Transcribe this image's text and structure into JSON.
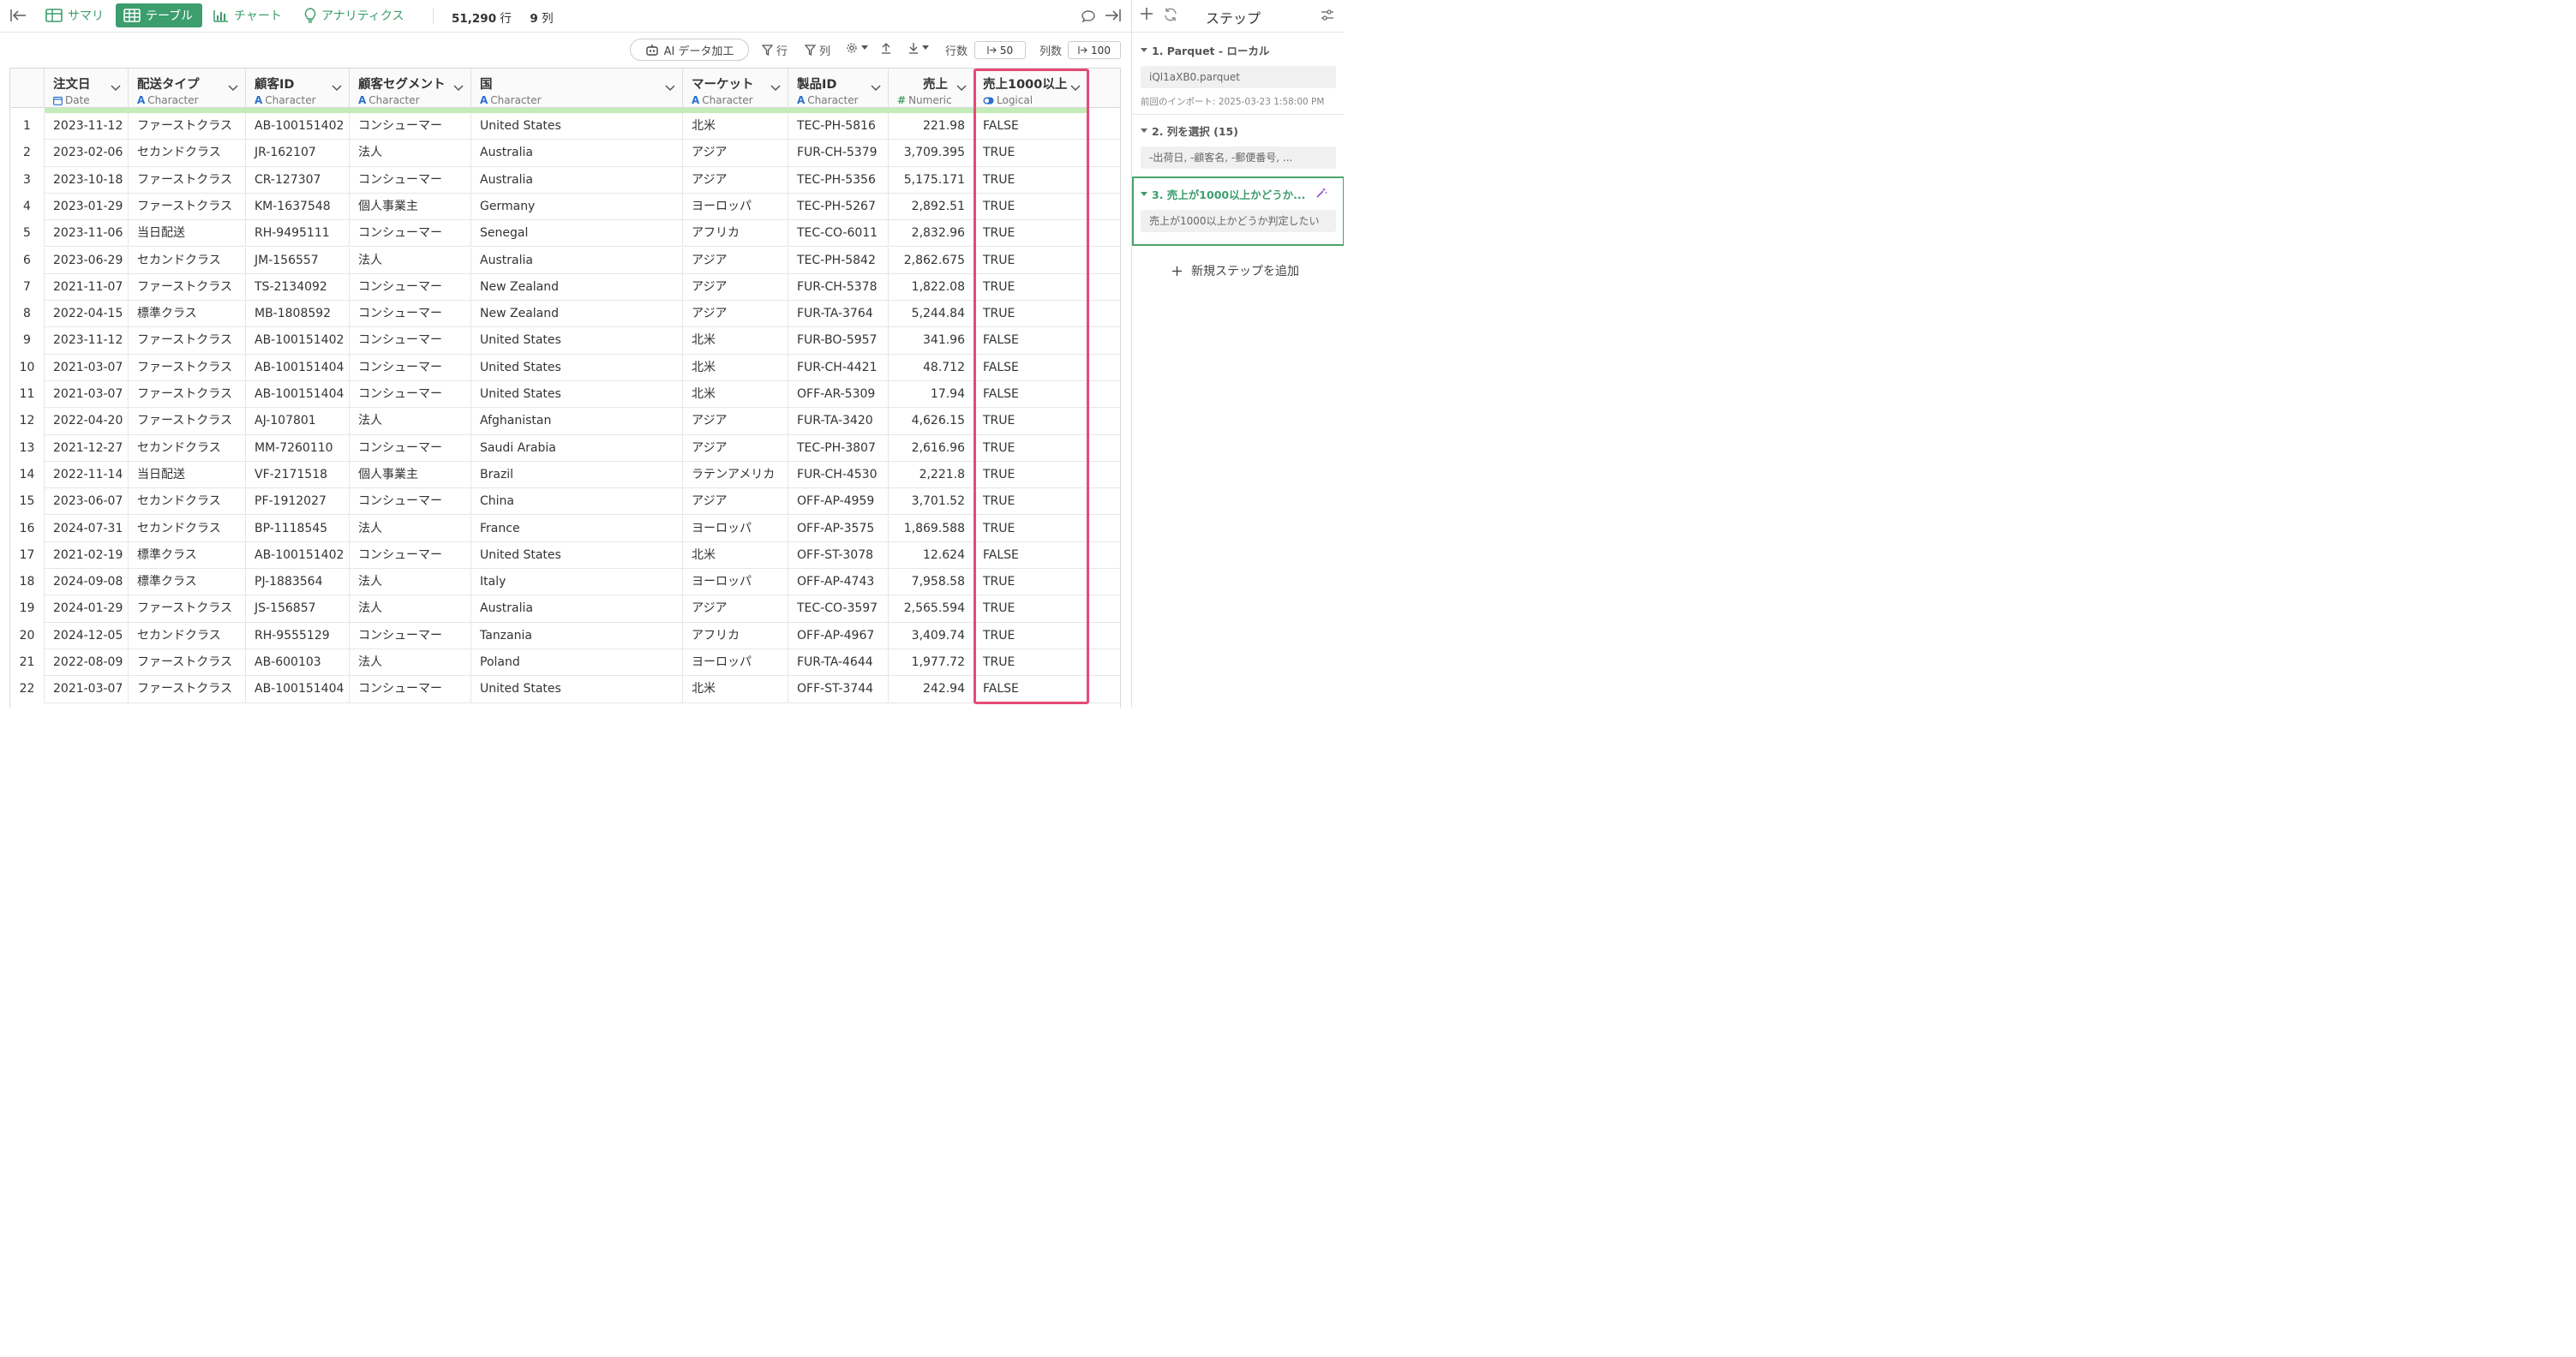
{
  "nav": {
    "tabs": [
      {
        "label": "サマリ",
        "icon": "summary-table-icon"
      },
      {
        "label": "テーブル",
        "icon": "table-icon"
      },
      {
        "label": "チャート",
        "icon": "bar-chart-icon"
      },
      {
        "label": "アナリティクス",
        "icon": "lightbulb-icon"
      }
    ],
    "row_count": "51,290",
    "row_unit": "行",
    "col_count": "9",
    "col_unit": "列"
  },
  "toolbar": {
    "ai_label": "AI データ加工",
    "row_filter": "行",
    "col_filter": "列",
    "rows_label": "行数",
    "rows_value": "50",
    "cols_label": "列数",
    "cols_value": "100"
  },
  "table": {
    "columns": [
      {
        "name": "注文日",
        "type": "Date",
        "type_icon": "calendar-icon"
      },
      {
        "name": "配送タイプ",
        "type": "Character",
        "type_icon": "character-A-icon"
      },
      {
        "name": "顧客ID",
        "type": "Character",
        "type_icon": "character-A-icon"
      },
      {
        "name": "顧客セグメント",
        "type": "Character",
        "type_icon": "character-A-icon"
      },
      {
        "name": "国",
        "type": "Character",
        "type_icon": "character-A-icon"
      },
      {
        "name": "マーケット",
        "type": "Character",
        "type_icon": "character-A-icon"
      },
      {
        "name": "製品ID",
        "type": "Character",
        "type_icon": "character-A-icon"
      },
      {
        "name": "売上",
        "type": "Numeric",
        "type_icon": "hash-icon"
      },
      {
        "name": "売上1000以上",
        "type": "Logical",
        "type_icon": "toggle-icon"
      }
    ],
    "rows": [
      [
        "1",
        "2023-11-12",
        "ファーストクラス",
        "AB-100151402",
        "コンシューマー",
        "United States",
        "北米",
        "TEC-PH-5816",
        "221.98",
        "FALSE"
      ],
      [
        "2",
        "2023-02-06",
        "セカンドクラス",
        "JR-162107",
        "法人",
        "Australia",
        "アジア",
        "FUR-CH-5379",
        "3,709.395",
        "TRUE"
      ],
      [
        "3",
        "2023-10-18",
        "ファーストクラス",
        "CR-127307",
        "コンシューマー",
        "Australia",
        "アジア",
        "TEC-PH-5356",
        "5,175.171",
        "TRUE"
      ],
      [
        "4",
        "2023-01-29",
        "ファーストクラス",
        "KM-1637548",
        "個人事業主",
        "Germany",
        "ヨーロッパ",
        "TEC-PH-5267",
        "2,892.51",
        "TRUE"
      ],
      [
        "5",
        "2023-11-06",
        "当日配送",
        "RH-9495111",
        "コンシューマー",
        "Senegal",
        "アフリカ",
        "TEC-CO-6011",
        "2,832.96",
        "TRUE"
      ],
      [
        "6",
        "2023-06-29",
        "セカンドクラス",
        "JM-156557",
        "法人",
        "Australia",
        "アジア",
        "TEC-PH-5842",
        "2,862.675",
        "TRUE"
      ],
      [
        "7",
        "2021-11-07",
        "ファーストクラス",
        "TS-2134092",
        "コンシューマー",
        "New Zealand",
        "アジア",
        "FUR-CH-5378",
        "1,822.08",
        "TRUE"
      ],
      [
        "8",
        "2022-04-15",
        "標準クラス",
        "MB-1808592",
        "コンシューマー",
        "New Zealand",
        "アジア",
        "FUR-TA-3764",
        "5,244.84",
        "TRUE"
      ],
      [
        "9",
        "2023-11-12",
        "ファーストクラス",
        "AB-100151402",
        "コンシューマー",
        "United States",
        "北米",
        "FUR-BO-5957",
        "341.96",
        "FALSE"
      ],
      [
        "10",
        "2021-03-07",
        "ファーストクラス",
        "AB-100151404",
        "コンシューマー",
        "United States",
        "北米",
        "FUR-CH-4421",
        "48.712",
        "FALSE"
      ],
      [
        "11",
        "2021-03-07",
        "ファーストクラス",
        "AB-100151404",
        "コンシューマー",
        "United States",
        "北米",
        "OFF-AR-5309",
        "17.94",
        "FALSE"
      ],
      [
        "12",
        "2022-04-20",
        "ファーストクラス",
        "AJ-107801",
        "法人",
        "Afghanistan",
        "アジア",
        "FUR-TA-3420",
        "4,626.15",
        "TRUE"
      ],
      [
        "13",
        "2021-12-27",
        "セカンドクラス",
        "MM-7260110",
        "コンシューマー",
        "Saudi Arabia",
        "アジア",
        "TEC-PH-3807",
        "2,616.96",
        "TRUE"
      ],
      [
        "14",
        "2022-11-14",
        "当日配送",
        "VF-2171518",
        "個人事業主",
        "Brazil",
        "ラテンアメリカ",
        "FUR-CH-4530",
        "2,221.8",
        "TRUE"
      ],
      [
        "15",
        "2023-06-07",
        "セカンドクラス",
        "PF-1912027",
        "コンシューマー",
        "China",
        "アジア",
        "OFF-AP-4959",
        "3,701.52",
        "TRUE"
      ],
      [
        "16",
        "2024-07-31",
        "セカンドクラス",
        "BP-1118545",
        "法人",
        "France",
        "ヨーロッパ",
        "OFF-AP-3575",
        "1,869.588",
        "TRUE"
      ],
      [
        "17",
        "2021-02-19",
        "標準クラス",
        "AB-100151402",
        "コンシューマー",
        "United States",
        "北米",
        "OFF-ST-3078",
        "12.624",
        "FALSE"
      ],
      [
        "18",
        "2024-09-08",
        "標準クラス",
        "PJ-1883564",
        "法人",
        "Italy",
        "ヨーロッパ",
        "OFF-AP-4743",
        "7,958.58",
        "TRUE"
      ],
      [
        "19",
        "2024-01-29",
        "ファーストクラス",
        "JS-156857",
        "法人",
        "Australia",
        "アジア",
        "TEC-CO-3597",
        "2,565.594",
        "TRUE"
      ],
      [
        "20",
        "2024-12-05",
        "セカンドクラス",
        "RH-9555129",
        "コンシューマー",
        "Tanzania",
        "アフリカ",
        "OFF-AP-4967",
        "3,409.74",
        "TRUE"
      ],
      [
        "21",
        "2022-08-09",
        "ファーストクラス",
        "AB-600103",
        "法人",
        "Poland",
        "ヨーロッパ",
        "FUR-TA-4644",
        "1,977.72",
        "TRUE"
      ],
      [
        "22",
        "2021-03-07",
        "ファーストクラス",
        "AB-100151404",
        "コンシューマー",
        "United States",
        "北米",
        "OFF-ST-3744",
        "242.94",
        "FALSE"
      ]
    ]
  },
  "steps_panel": {
    "title": "ステップ",
    "steps": [
      {
        "title": "1. Parquet - ローカル",
        "body": "iQl1aXB0.parquet",
        "sub": "前回のインポート: 2025-03-23 1:58:00 PM"
      },
      {
        "title": "2. 列を選択 (15)",
        "body": "-出荷日, -顧客名, -郵便番号, ..."
      },
      {
        "title": "3. 売上が1000以上かどうか...",
        "body": "売上が1000以上かどうか判定したい"
      }
    ],
    "add_step": "新規ステップを追加"
  },
  "colors": {
    "accent_green": "#3c9d6d",
    "highlight_pink": "#e54a77",
    "type_blue": "#2c6fd1",
    "numeric_green": "#4aa36b",
    "quality_bar": "#c4ecb8",
    "magic_purple": "#8a4fd6"
  }
}
